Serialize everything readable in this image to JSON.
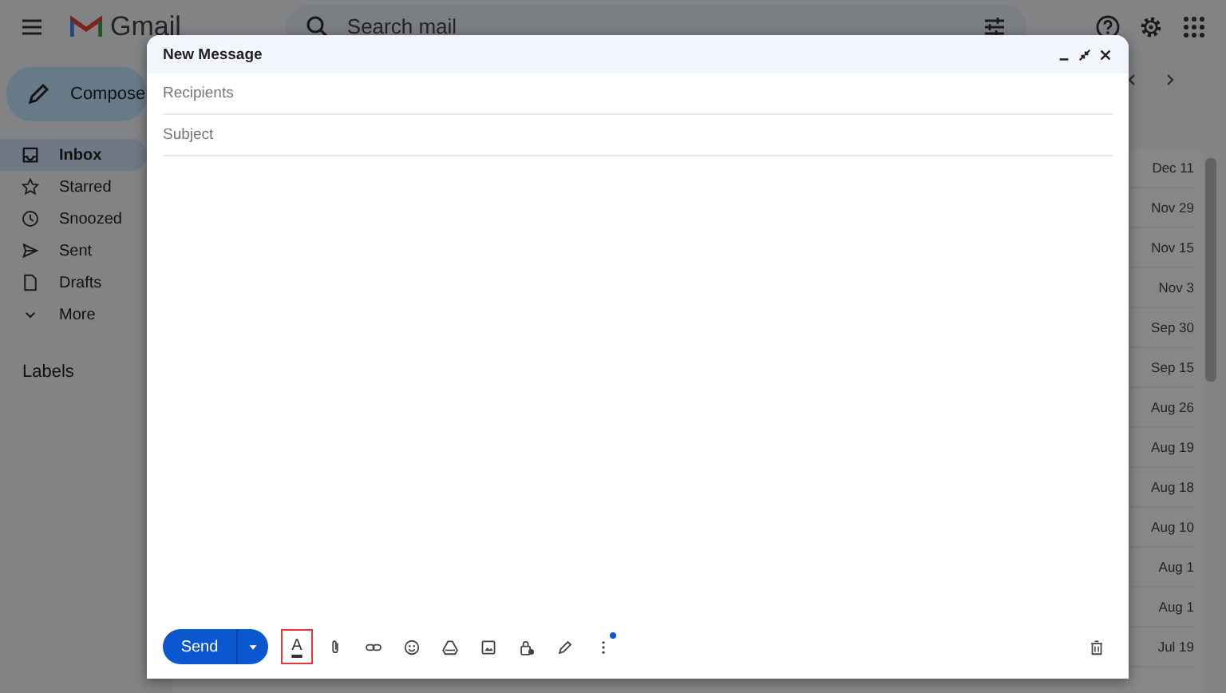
{
  "header": {
    "logo": "Gmail",
    "search": {
      "placeholder": "Search mail"
    }
  },
  "sidebar": {
    "compose": "Compose",
    "items": [
      {
        "label": "Inbox",
        "selected": true
      },
      {
        "label": "Starred",
        "selected": false
      },
      {
        "label": "Snoozed",
        "selected": false
      },
      {
        "label": "Sent",
        "selected": false
      },
      {
        "label": "Drafts",
        "selected": false
      },
      {
        "label": "More",
        "selected": false
      }
    ],
    "labels_heading": "Labels"
  },
  "mail_list": {
    "dates": [
      "Dec 11",
      "Nov 29",
      "Nov 15",
      "Nov 3",
      "Sep 30",
      "Sep 15",
      "Aug 26",
      "Aug 19",
      "Aug 18",
      "Aug 10",
      "Aug 1",
      "Aug 1",
      "Jul 19"
    ]
  },
  "compose_window": {
    "title": "New Message",
    "recipients": {
      "placeholder": "Recipients"
    },
    "subject": {
      "placeholder": "Subject"
    },
    "send": "Send",
    "format_button": {
      "label": "A",
      "highlighted": true
    },
    "more_options": {
      "notification": true
    }
  }
}
